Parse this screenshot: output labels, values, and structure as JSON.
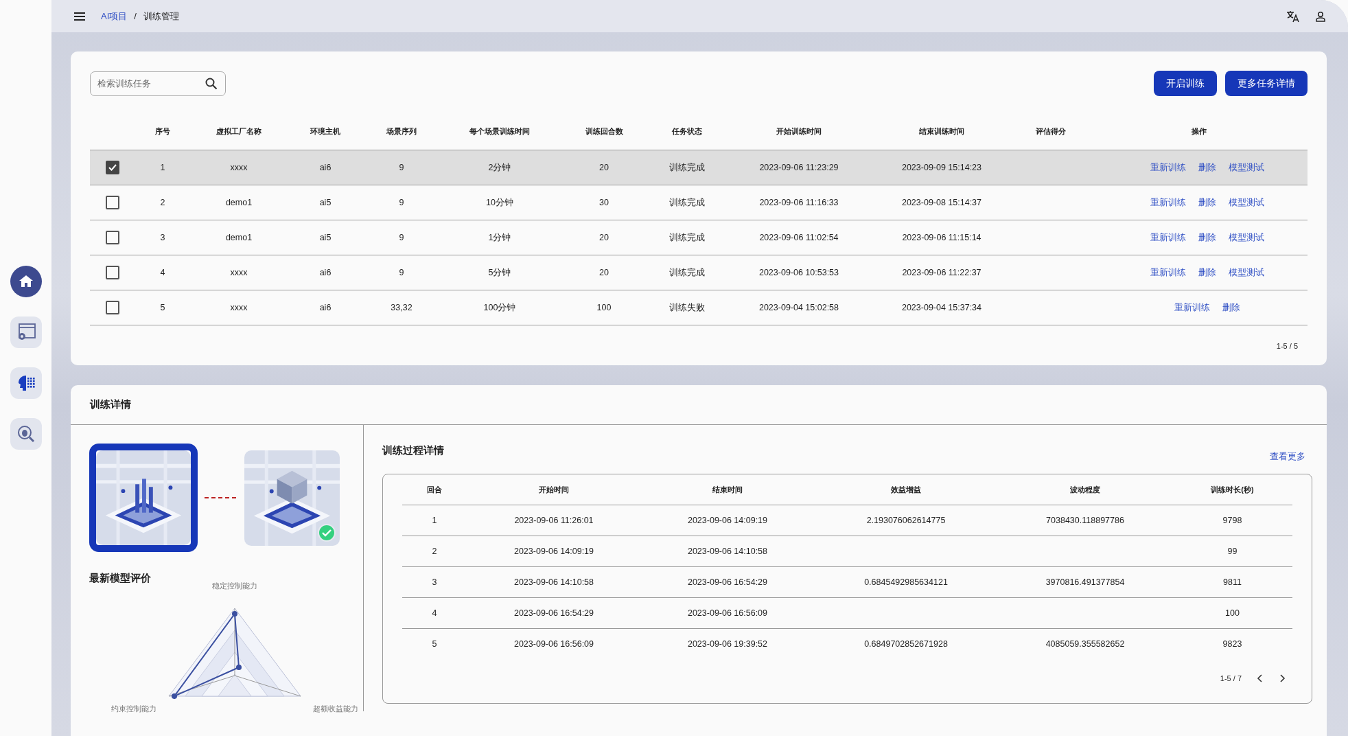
{
  "sidebar": {
    "items": [
      {
        "kind": "home",
        "selected": true
      },
      {
        "kind": "settings",
        "selected": false
      },
      {
        "kind": "ai",
        "selected": false
      },
      {
        "kind": "debug",
        "selected": false
      }
    ]
  },
  "topbar": {
    "breadcrumb": [
      {
        "label": "AI项目",
        "kind": "link"
      },
      {
        "label": "训练管理",
        "kind": "current"
      }
    ],
    "separator": "/"
  },
  "tasks": {
    "search": {
      "placeholder": "检索训练任务"
    },
    "buttons": [
      "开启训练",
      "更多任务详情"
    ],
    "columns": [
      "序号",
      "虚拟工厂名称",
      "环境主机",
      "场景序列",
      "每个场景训练时间",
      "训练回合数",
      "任务状态",
      "开始训练时间",
      "结束训练时间",
      "评估得分",
      "操作"
    ],
    "rows": [
      {
        "selected": true,
        "cells": [
          "1",
          "xxxx",
          "ai6",
          "9",
          "2分钟",
          "20",
          "训练完成",
          "2023-09-06 11:23:29",
          "2023-09-09 15:14:23",
          ""
        ],
        "actions": [
          "重新训练",
          "删除",
          "模型测试"
        ]
      },
      {
        "selected": false,
        "cells": [
          "2",
          "demo1",
          "ai5",
          "9",
          "10分钟",
          "30",
          "训练完成",
          "2023-09-06 11:16:33",
          "2023-09-08 15:14:37",
          ""
        ],
        "actions": [
          "重新训练",
          "删除",
          "模型测试"
        ]
      },
      {
        "selected": false,
        "cells": [
          "3",
          "demo1",
          "ai5",
          "9",
          "1分钟",
          "20",
          "训练完成",
          "2023-09-06 11:02:54",
          "2023-09-06 11:15:14",
          ""
        ],
        "actions": [
          "重新训练",
          "删除",
          "模型测试"
        ]
      },
      {
        "selected": false,
        "cells": [
          "4",
          "xxxx",
          "ai6",
          "9",
          "5分钟",
          "20",
          "训练完成",
          "2023-09-06 10:53:53",
          "2023-09-06 11:22:37",
          ""
        ],
        "actions": [
          "重新训练",
          "删除",
          "模型测试"
        ]
      },
      {
        "selected": false,
        "cells": [
          "5",
          "xxxx",
          "ai6",
          "33,32",
          "100分钟",
          "100",
          "训练失败",
          "2023-09-04 15:02:58",
          "2023-09-04 15:37:34",
          ""
        ],
        "actions": [
          "重新训练",
          "删除"
        ]
      }
    ],
    "pagination": "1-5 / 5"
  },
  "details": {
    "title": "训练详情",
    "scenes": [
      {
        "kind": "picture",
        "selected": true,
        "completed": false
      },
      {
        "kind": "picture",
        "selected": false,
        "completed": true
      }
    ],
    "evaluation": {
      "title": "最新模型评价",
      "axes": [
        "稳定控制能力",
        "超额收益能力",
        "约束控制能力"
      ]
    },
    "process": {
      "title": "训练过程详情",
      "more_link": "查看更多",
      "columns": [
        "回合",
        "开始时间",
        "结束时间",
        "效益增益",
        "波动程度",
        "训练时长(秒)"
      ],
      "rows": [
        [
          "1",
          "2023-09-06 11:26:01",
          "2023-09-06 14:09:19",
          "2.193076062614775",
          "7038430.118897786",
          "9798"
        ],
        [
          "2",
          "2023-09-06 14:09:19",
          "2023-09-06 14:10:58",
          "",
          "",
          "99"
        ],
        [
          "3",
          "2023-09-06 14:10:58",
          "2023-09-06 16:54:29",
          "0.6845492985634121",
          "3970816.491377854",
          "9811"
        ],
        [
          "4",
          "2023-09-06 16:54:29",
          "2023-09-06 16:56:09",
          "",
          "",
          "100"
        ],
        [
          "5",
          "2023-09-06 16:56:09",
          "2023-09-06 19:39:52",
          "0.6849702852671928",
          "4085059.355582652",
          "9823"
        ]
      ],
      "pagination": "1-5 / 7"
    }
  }
}
